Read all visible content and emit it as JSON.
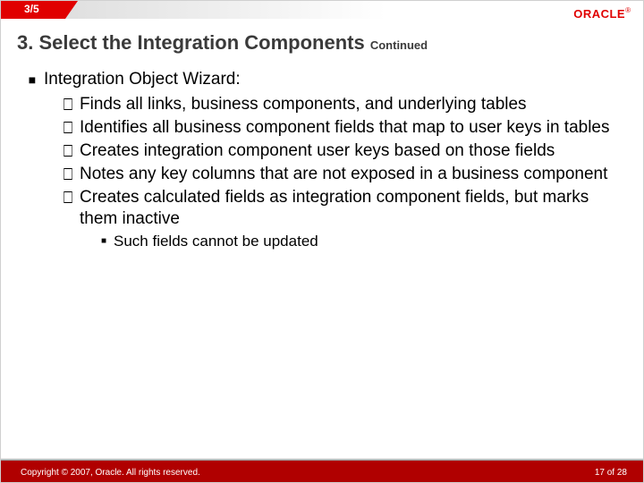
{
  "header": {
    "section_counter": "3/5",
    "logo_text": "ORACLE",
    "logo_reg": "®"
  },
  "title": {
    "main": "3. Select the Integration Components",
    "cont": "Continued"
  },
  "content": {
    "lvl1_text": "Integration Object Wizard:",
    "lvl2": [
      "Finds all links, business components, and underlying tables",
      "Identifies all business component fields that map to user keys in tables",
      "Creates integration component user keys based on those fields",
      "Notes any key columns that are not exposed in a business component",
      "Creates calculated fields as integration component fields, but marks them inactive"
    ],
    "lvl3_under_last": "Such fields cannot be updated"
  },
  "footer": {
    "copyright": "Copyright © 2007, Oracle. All rights reserved.",
    "page_current": "17",
    "page_sep": " of ",
    "page_total": "28"
  },
  "bullets": {
    "square": "■",
    "hollow": "⎕"
  }
}
